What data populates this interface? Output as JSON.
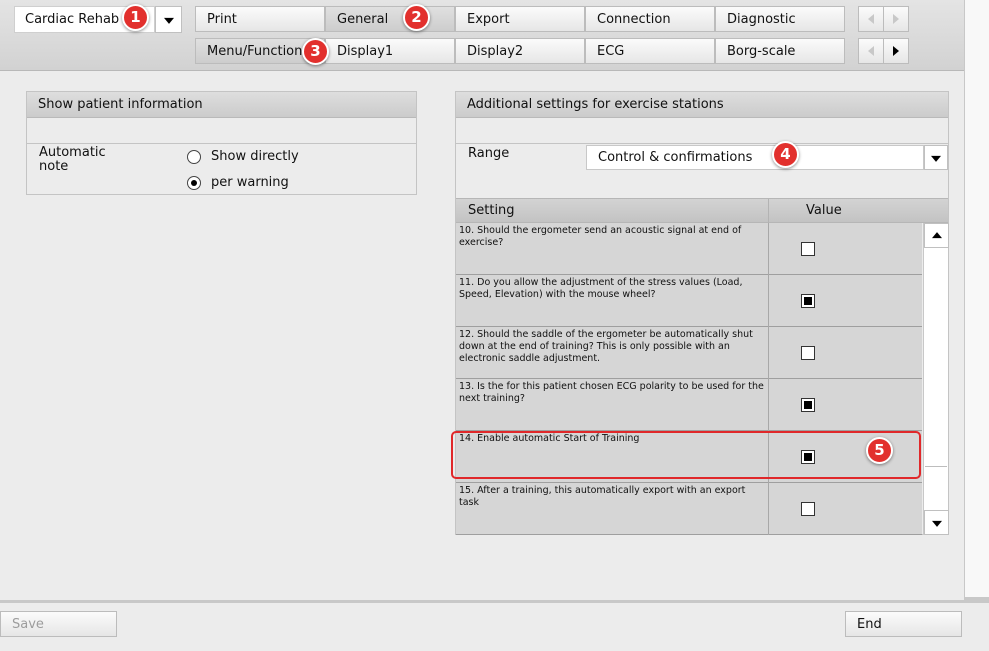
{
  "module": {
    "value": "Cardiac Rehab"
  },
  "tabs_row1": [
    {
      "label": "Print"
    },
    {
      "label": "General"
    },
    {
      "label": "Export"
    },
    {
      "label": "Connection"
    },
    {
      "label": "Diagnostic"
    }
  ],
  "tabs_row2": [
    {
      "label": "Menu/Functions"
    },
    {
      "label": "Display1"
    },
    {
      "label": "Display2"
    },
    {
      "label": "ECG"
    },
    {
      "label": "Borg-scale"
    }
  ],
  "badges": [
    "1",
    "2",
    "3",
    "4",
    "5"
  ],
  "patient_info": {
    "title": "Show patient information",
    "field_label": "Automatic\nnote",
    "options": [
      {
        "label": "Show directly",
        "selected": false
      },
      {
        "label": "per warning",
        "selected": true
      }
    ]
  },
  "exercise_settings": {
    "title": "Additional settings for exercise stations",
    "range_label": "Range",
    "range_value": "Control & confirmations",
    "col_setting": "Setting",
    "col_value": "Value",
    "rows": [
      {
        "text": "10. Should the ergometer send an acoustic signal at end of exercise?",
        "checked": false
      },
      {
        "text": "11. Do you allow the adjustment of the stress values (Load, Speed, Elevation) with the mouse wheel?",
        "checked": true
      },
      {
        "text": "12. Should the saddle of the ergometer be automatically shut down at the end of training?  This is only possible with an electronic saddle adjustment.",
        "checked": false
      },
      {
        "text": "13. Is the for this patient chosen ECG polarity to be used for the next training?",
        "checked": true
      },
      {
        "text": "14. Enable automatic Start of Training",
        "checked": true
      },
      {
        "text": "15. After a training, this automatically export with an export task",
        "checked": false
      }
    ]
  },
  "footer": {
    "save": "Save",
    "end": "End"
  },
  "colors": {
    "badge": "#e2302d",
    "highlight": "#e0282a"
  }
}
